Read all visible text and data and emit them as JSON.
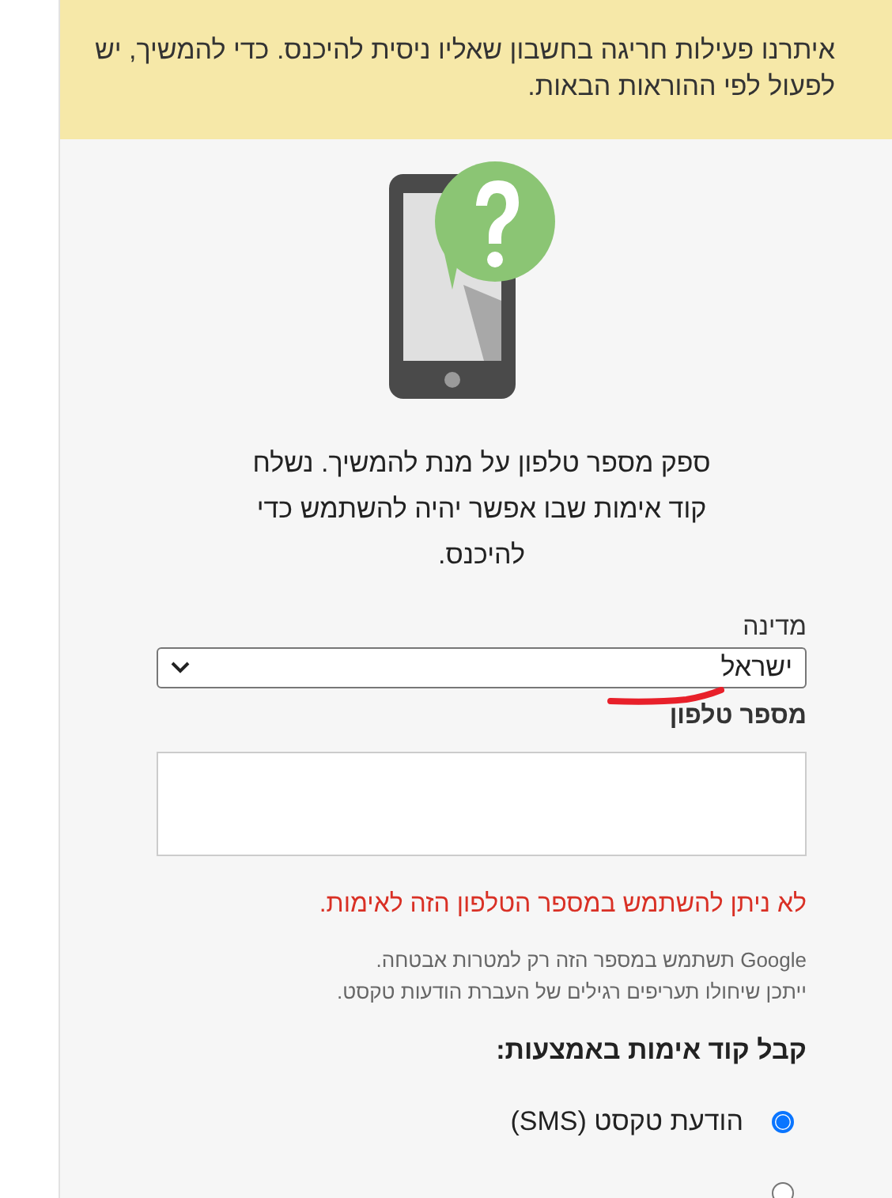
{
  "banner": {
    "text": "איתרנו פעילות חריגה בחשבון שאליו ניסית להיכנס. כדי להמשיך, יש לפעול לפי ההוראות הבאות."
  },
  "instructions": "ספק מספר טלפון על מנת להמשיך. נשלח קוד אימות שבו אפשר יהיה להשתמש כדי להיכנס.",
  "country": {
    "label": "מדינה",
    "value": "ישראל"
  },
  "phone": {
    "label": "מספר טלפון"
  },
  "error": "לא ניתן להשתמש במספר הטלפון הזה לאימות.",
  "notes": [
    "Google תשתמש במספר הזה רק למטרות אבטחה.",
    "ייתכן שיחולו תעריפים רגילים של העברת הודעות טקסט."
  ],
  "method_heading": "קבל קוד אימות באמצעות:",
  "methods": [
    {
      "label": "הודעת טקסט (SMS)",
      "selected": true
    },
    {
      "selected": false
    }
  ]
}
